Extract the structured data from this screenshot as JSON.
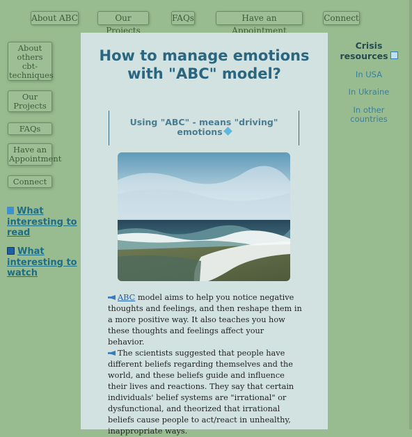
{
  "top_nav": [
    "About ABC",
    "Our Projects",
    "FAQs",
    "Have an Appointment",
    "Connect"
  ],
  "side_nav": {
    "buttons": [
      "About others cbt-techniques",
      "Our Projects",
      "FAQs",
      "Have an Appointment",
      "Connect"
    ],
    "links": [
      {
        "label": "What interesting to read",
        "icon": "book-icon"
      },
      {
        "label": "What interesting to watch",
        "icon": "tv-icon"
      }
    ]
  },
  "main": {
    "title": "How to manage emotions with \"ABC\" model?",
    "subtitle": "Using \"ABC\" - means \"driving\" emotions",
    "paragraphs": [
      {
        "link": "ABC",
        "text": " model aims to help you notice negative thoughts and feelings, and then reshape them in a more positive way. It also teaches you how these thoughts and feelings affect your behavior."
      },
      {
        "text": "The scientists suggested that people have different beliefs regarding themselves and the world, and these beliefs guide and influence their lives and reactions. They say that certain individuals' belief systems are \"irrational\" or dysfunctional, and theorized that irrational beliefs cause people to act/react in unhealthy, inappropriate ways."
      }
    ]
  },
  "right": {
    "title": "Crisis resources",
    "links": [
      "In USA",
      "In Ukraine",
      "In other countries"
    ]
  },
  "colors": {
    "background": "#98bc90",
    "content": "#d2e2e0",
    "heading": "#2a6680",
    "link": "#1d6d86"
  }
}
